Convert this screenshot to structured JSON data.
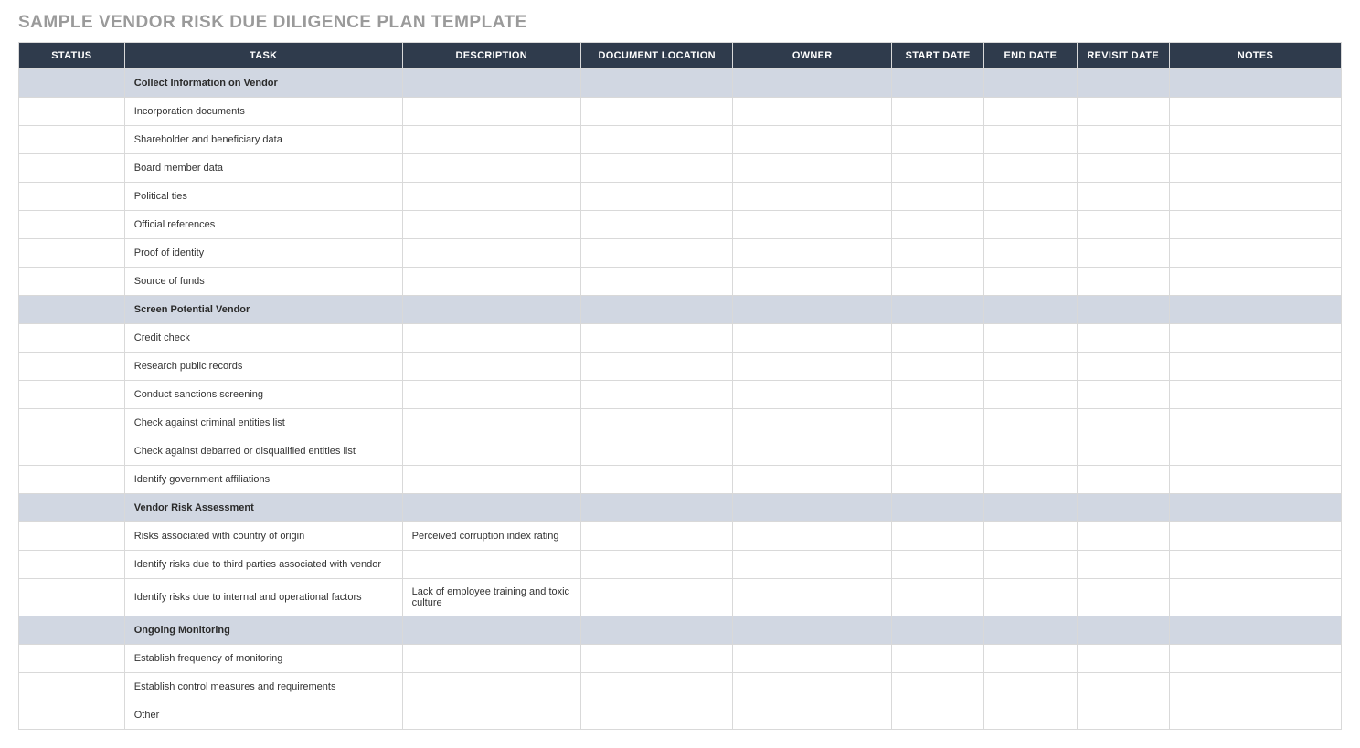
{
  "title": "SAMPLE VENDOR RISK DUE DILIGENCE PLAN TEMPLATE",
  "columns": {
    "status": "STATUS",
    "task": "TASK",
    "description": "DESCRIPTION",
    "document_location": "DOCUMENT LOCATION",
    "owner": "OWNER",
    "start_date": "START DATE",
    "end_date": "END DATE",
    "revisit_date": "REVISIT DATE",
    "notes": "NOTES"
  },
  "rows": [
    {
      "section": true,
      "status": "",
      "task": "Collect Information on Vendor",
      "description": "",
      "document_location": "",
      "owner": "",
      "start_date": "",
      "end_date": "",
      "revisit_date": "",
      "notes": ""
    },
    {
      "section": false,
      "status": "",
      "task": "Incorporation documents",
      "description": "",
      "document_location": "",
      "owner": "",
      "start_date": "",
      "end_date": "",
      "revisit_date": "",
      "notes": ""
    },
    {
      "section": false,
      "status": "",
      "task": "Shareholder and beneficiary data",
      "description": "",
      "document_location": "",
      "owner": "",
      "start_date": "",
      "end_date": "",
      "revisit_date": "",
      "notes": ""
    },
    {
      "section": false,
      "status": "",
      "task": "Board member data",
      "description": "",
      "document_location": "",
      "owner": "",
      "start_date": "",
      "end_date": "",
      "revisit_date": "",
      "notes": ""
    },
    {
      "section": false,
      "status": "",
      "task": "Political ties",
      "description": "",
      "document_location": "",
      "owner": "",
      "start_date": "",
      "end_date": "",
      "revisit_date": "",
      "notes": ""
    },
    {
      "section": false,
      "status": "",
      "task": "Official references",
      "description": "",
      "document_location": "",
      "owner": "",
      "start_date": "",
      "end_date": "",
      "revisit_date": "",
      "notes": ""
    },
    {
      "section": false,
      "status": "",
      "task": "Proof of identity",
      "description": "",
      "document_location": "",
      "owner": "",
      "start_date": "",
      "end_date": "",
      "revisit_date": "",
      "notes": ""
    },
    {
      "section": false,
      "status": "",
      "task": "Source of funds",
      "description": "",
      "document_location": "",
      "owner": "",
      "start_date": "",
      "end_date": "",
      "revisit_date": "",
      "notes": ""
    },
    {
      "section": true,
      "status": "",
      "task": "Screen Potential Vendor",
      "description": "",
      "document_location": "",
      "owner": "",
      "start_date": "",
      "end_date": "",
      "revisit_date": "",
      "notes": ""
    },
    {
      "section": false,
      "status": "",
      "task": "Credit check",
      "description": "",
      "document_location": "",
      "owner": "",
      "start_date": "",
      "end_date": "",
      "revisit_date": "",
      "notes": ""
    },
    {
      "section": false,
      "status": "",
      "task": "Research public records",
      "description": "",
      "document_location": "",
      "owner": "",
      "start_date": "",
      "end_date": "",
      "revisit_date": "",
      "notes": ""
    },
    {
      "section": false,
      "status": "",
      "task": "Conduct sanctions screening",
      "description": "",
      "document_location": "",
      "owner": "",
      "start_date": "",
      "end_date": "",
      "revisit_date": "",
      "notes": ""
    },
    {
      "section": false,
      "status": "",
      "task": "Check against criminal entities list",
      "description": "",
      "document_location": "",
      "owner": "",
      "start_date": "",
      "end_date": "",
      "revisit_date": "",
      "notes": ""
    },
    {
      "section": false,
      "status": "",
      "task": "Check against debarred or disqualified entities list",
      "description": "",
      "document_location": "",
      "owner": "",
      "start_date": "",
      "end_date": "",
      "revisit_date": "",
      "notes": ""
    },
    {
      "section": false,
      "status": "",
      "task": "Identify government affiliations",
      "description": "",
      "document_location": "",
      "owner": "",
      "start_date": "",
      "end_date": "",
      "revisit_date": "",
      "notes": ""
    },
    {
      "section": true,
      "status": "",
      "task": "Vendor Risk Assessment",
      "description": "",
      "document_location": "",
      "owner": "",
      "start_date": "",
      "end_date": "",
      "revisit_date": "",
      "notes": ""
    },
    {
      "section": false,
      "status": "",
      "task": "Risks associated with country of origin",
      "description": "Perceived corruption index rating",
      "document_location": "",
      "owner": "",
      "start_date": "",
      "end_date": "",
      "revisit_date": "",
      "notes": ""
    },
    {
      "section": false,
      "status": "",
      "task": "Identify risks due to third parties associated with vendor",
      "description": "",
      "document_location": "",
      "owner": "",
      "start_date": "",
      "end_date": "",
      "revisit_date": "",
      "notes": ""
    },
    {
      "section": false,
      "status": "",
      "task": "Identify risks due to internal and operational factors",
      "description": "Lack of employee training and toxic culture",
      "document_location": "",
      "owner": "",
      "start_date": "",
      "end_date": "",
      "revisit_date": "",
      "notes": ""
    },
    {
      "section": true,
      "status": "",
      "task": "Ongoing Monitoring",
      "description": "",
      "document_location": "",
      "owner": "",
      "start_date": "",
      "end_date": "",
      "revisit_date": "",
      "notes": ""
    },
    {
      "section": false,
      "status": "",
      "task": "Establish frequency of monitoring",
      "description": "",
      "document_location": "",
      "owner": "",
      "start_date": "",
      "end_date": "",
      "revisit_date": "",
      "notes": ""
    },
    {
      "section": false,
      "status": "",
      "task": "Establish control measures and requirements",
      "description": "",
      "document_location": "",
      "owner": "",
      "start_date": "",
      "end_date": "",
      "revisit_date": "",
      "notes": ""
    },
    {
      "section": false,
      "status": "",
      "task": "Other",
      "description": "",
      "document_location": "",
      "owner": "",
      "start_date": "",
      "end_date": "",
      "revisit_date": "",
      "notes": ""
    }
  ]
}
